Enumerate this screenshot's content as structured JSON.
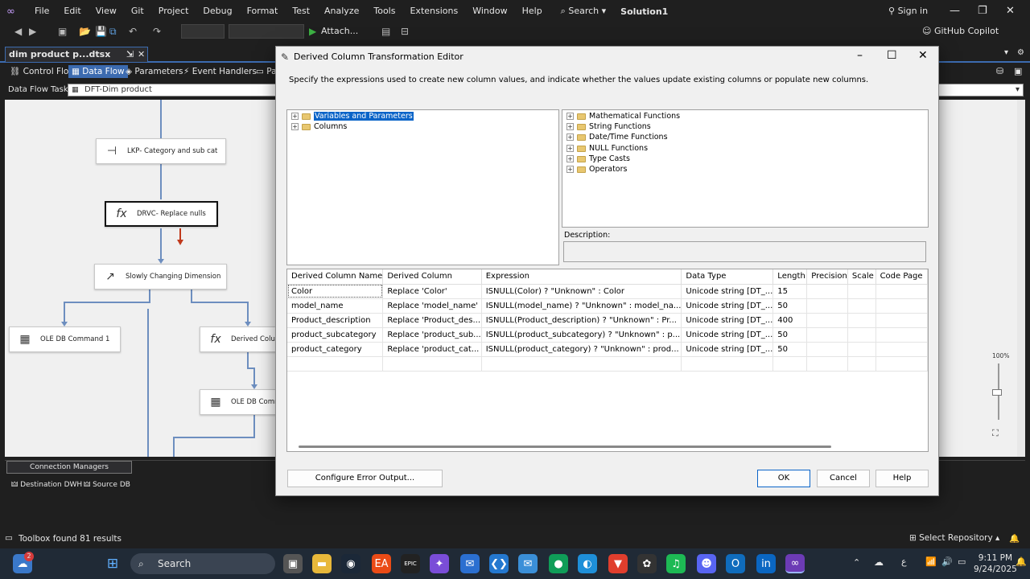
{
  "menubar": {
    "items": [
      "File",
      "Edit",
      "View",
      "Git",
      "Project",
      "Debug",
      "Format",
      "Test",
      "Analyze",
      "Tools",
      "Extensions",
      "Window",
      "Help"
    ],
    "search_label": "Search",
    "solution": "Solution1",
    "sign_in": "Sign in"
  },
  "toolbar": {
    "attach_label": "Attach...",
    "copilot_label": "GitHub Copilot"
  },
  "doc_tab": {
    "title": "dim product p...dtsx [Design]"
  },
  "designer_tabs": [
    "Control Flow",
    "Data Flow",
    "Parameters",
    "Event Handlers",
    "Pa"
  ],
  "task": {
    "label": "Data Flow Task:",
    "value": "DFT-Dim product"
  },
  "canvas": {
    "nodes": {
      "lkp": "LKP- Category and sub cat",
      "drvc": "DRVC- Replace nulls",
      "scd": "Slowly Changing Dimension",
      "ole1": "OLE DB Command 1",
      "derived": "Derived Colum",
      "ole2": "OLE DB Comm"
    }
  },
  "dialog": {
    "title": "Derived Column Transformation Editor",
    "description": "Specify the expressions used to create new column values, and indicate whether the values update existing columns or populate new columns.",
    "left_tree": [
      "Variables and Parameters",
      "Columns"
    ],
    "right_tree": [
      "Mathematical Functions",
      "String Functions",
      "Date/Time Functions",
      "NULL Functions",
      "Type Casts",
      "Operators"
    ],
    "desc_label": "Description:",
    "grid": {
      "headers": [
        "Derived Column Name",
        "Derived Column",
        "Expression",
        "Data Type",
        "Length",
        "Precision",
        "Scale",
        "Code Page"
      ],
      "rows": [
        [
          "Color",
          "Replace 'Color'",
          "ISNULL(Color) ? \"Unknown\" : Color",
          "Unicode string [DT_...",
          "15",
          "",
          "",
          ""
        ],
        [
          "model_name",
          "Replace 'model_name'",
          "ISNULL(model_name) ? \"Unknown\" : model_na...",
          "Unicode string [DT_...",
          "50",
          "",
          "",
          ""
        ],
        [
          "Product_description",
          "Replace 'Product_des...",
          "ISNULL(Product_description) ? \"Unknown\" : Pr...",
          "Unicode string [DT_...",
          "400",
          "",
          "",
          ""
        ],
        [
          "product_subcategory",
          "Replace 'product_sub...",
          "ISNULL(product_subcategory) ? \"Unknown\" : p...",
          "Unicode string [DT_...",
          "50",
          "",
          "",
          ""
        ],
        [
          "product_category",
          "Replace 'product_cat...",
          "ISNULL(product_category) ? \"Unknown\" : prod...",
          "Unicode string [DT_...",
          "50",
          "",
          "",
          ""
        ]
      ]
    },
    "buttons": {
      "configure": "Configure Error Output...",
      "ok": "OK",
      "cancel": "Cancel",
      "help": "Help"
    }
  },
  "connection_managers": {
    "title": "Connection Managers",
    "items": [
      "Destination DWH",
      "Source DB"
    ]
  },
  "zoom": "100%",
  "statusbar": {
    "toolbox": "Toolbox found 81 results",
    "repo": "Select Repository"
  },
  "taskbar": {
    "search": "Search",
    "time": "9:11 PM",
    "date": "9/24/2025",
    "badge": "2"
  }
}
